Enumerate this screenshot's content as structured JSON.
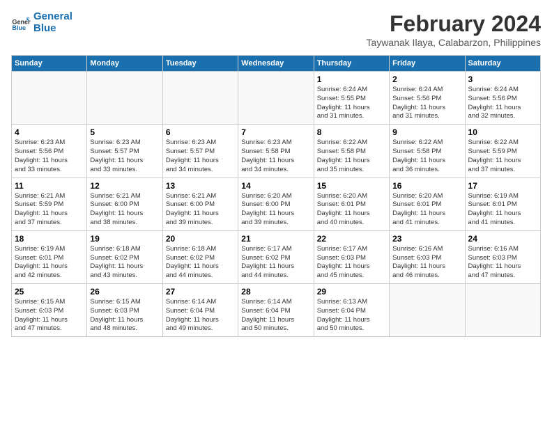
{
  "logo": {
    "line1": "General",
    "line2": "Blue"
  },
  "title": "February 2024",
  "location": "Taywanak Ilaya, Calabarzon, Philippines",
  "days_of_week": [
    "Sunday",
    "Monday",
    "Tuesday",
    "Wednesday",
    "Thursday",
    "Friday",
    "Saturday"
  ],
  "weeks": [
    [
      {
        "day": "",
        "info": ""
      },
      {
        "day": "",
        "info": ""
      },
      {
        "day": "",
        "info": ""
      },
      {
        "day": "",
        "info": ""
      },
      {
        "day": "1",
        "info": "Sunrise: 6:24 AM\nSunset: 5:55 PM\nDaylight: 11 hours\nand 31 minutes."
      },
      {
        "day": "2",
        "info": "Sunrise: 6:24 AM\nSunset: 5:56 PM\nDaylight: 11 hours\nand 31 minutes."
      },
      {
        "day": "3",
        "info": "Sunrise: 6:24 AM\nSunset: 5:56 PM\nDaylight: 11 hours\nand 32 minutes."
      }
    ],
    [
      {
        "day": "4",
        "info": "Sunrise: 6:23 AM\nSunset: 5:56 PM\nDaylight: 11 hours\nand 33 minutes."
      },
      {
        "day": "5",
        "info": "Sunrise: 6:23 AM\nSunset: 5:57 PM\nDaylight: 11 hours\nand 33 minutes."
      },
      {
        "day": "6",
        "info": "Sunrise: 6:23 AM\nSunset: 5:57 PM\nDaylight: 11 hours\nand 34 minutes."
      },
      {
        "day": "7",
        "info": "Sunrise: 6:23 AM\nSunset: 5:58 PM\nDaylight: 11 hours\nand 34 minutes."
      },
      {
        "day": "8",
        "info": "Sunrise: 6:22 AM\nSunset: 5:58 PM\nDaylight: 11 hours\nand 35 minutes."
      },
      {
        "day": "9",
        "info": "Sunrise: 6:22 AM\nSunset: 5:58 PM\nDaylight: 11 hours\nand 36 minutes."
      },
      {
        "day": "10",
        "info": "Sunrise: 6:22 AM\nSunset: 5:59 PM\nDaylight: 11 hours\nand 37 minutes."
      }
    ],
    [
      {
        "day": "11",
        "info": "Sunrise: 6:21 AM\nSunset: 5:59 PM\nDaylight: 11 hours\nand 37 minutes."
      },
      {
        "day": "12",
        "info": "Sunrise: 6:21 AM\nSunset: 6:00 PM\nDaylight: 11 hours\nand 38 minutes."
      },
      {
        "day": "13",
        "info": "Sunrise: 6:21 AM\nSunset: 6:00 PM\nDaylight: 11 hours\nand 39 minutes."
      },
      {
        "day": "14",
        "info": "Sunrise: 6:20 AM\nSunset: 6:00 PM\nDaylight: 11 hours\nand 39 minutes."
      },
      {
        "day": "15",
        "info": "Sunrise: 6:20 AM\nSunset: 6:01 PM\nDaylight: 11 hours\nand 40 minutes."
      },
      {
        "day": "16",
        "info": "Sunrise: 6:20 AM\nSunset: 6:01 PM\nDaylight: 11 hours\nand 41 minutes."
      },
      {
        "day": "17",
        "info": "Sunrise: 6:19 AM\nSunset: 6:01 PM\nDaylight: 11 hours\nand 41 minutes."
      }
    ],
    [
      {
        "day": "18",
        "info": "Sunrise: 6:19 AM\nSunset: 6:01 PM\nDaylight: 11 hours\nand 42 minutes."
      },
      {
        "day": "19",
        "info": "Sunrise: 6:18 AM\nSunset: 6:02 PM\nDaylight: 11 hours\nand 43 minutes."
      },
      {
        "day": "20",
        "info": "Sunrise: 6:18 AM\nSunset: 6:02 PM\nDaylight: 11 hours\nand 44 minutes."
      },
      {
        "day": "21",
        "info": "Sunrise: 6:17 AM\nSunset: 6:02 PM\nDaylight: 11 hours\nand 44 minutes."
      },
      {
        "day": "22",
        "info": "Sunrise: 6:17 AM\nSunset: 6:03 PM\nDaylight: 11 hours\nand 45 minutes."
      },
      {
        "day": "23",
        "info": "Sunrise: 6:16 AM\nSunset: 6:03 PM\nDaylight: 11 hours\nand 46 minutes."
      },
      {
        "day": "24",
        "info": "Sunrise: 6:16 AM\nSunset: 6:03 PM\nDaylight: 11 hours\nand 47 minutes."
      }
    ],
    [
      {
        "day": "25",
        "info": "Sunrise: 6:15 AM\nSunset: 6:03 PM\nDaylight: 11 hours\nand 47 minutes."
      },
      {
        "day": "26",
        "info": "Sunrise: 6:15 AM\nSunset: 6:03 PM\nDaylight: 11 hours\nand 48 minutes."
      },
      {
        "day": "27",
        "info": "Sunrise: 6:14 AM\nSunset: 6:04 PM\nDaylight: 11 hours\nand 49 minutes."
      },
      {
        "day": "28",
        "info": "Sunrise: 6:14 AM\nSunset: 6:04 PM\nDaylight: 11 hours\nand 50 minutes."
      },
      {
        "day": "29",
        "info": "Sunrise: 6:13 AM\nSunset: 6:04 PM\nDaylight: 11 hours\nand 50 minutes."
      },
      {
        "day": "",
        "info": ""
      },
      {
        "day": "",
        "info": ""
      }
    ]
  ]
}
